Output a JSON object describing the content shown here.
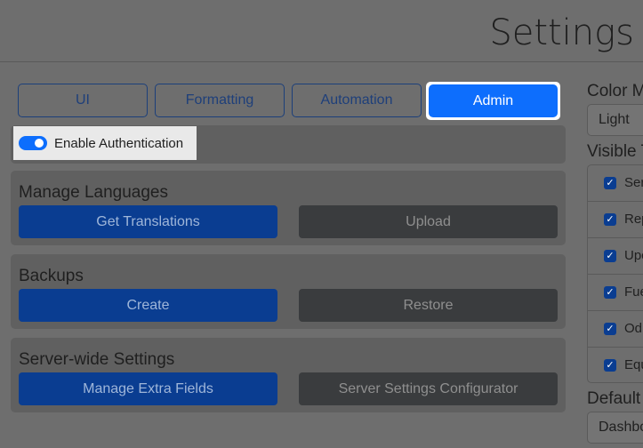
{
  "header": {
    "title": "Settings"
  },
  "tabs": [
    "UI",
    "Formatting",
    "Automation",
    "Admin"
  ],
  "auth": {
    "label": "Enable Authentication",
    "enabled": true
  },
  "sections": [
    {
      "title": "Manage Languages",
      "primary": "Get Translations",
      "secondary": "Upload"
    },
    {
      "title": "Backups",
      "primary": "Create",
      "secondary": "Restore"
    },
    {
      "title": "Server-wide Settings",
      "primary": "Manage Extra Fields",
      "secondary": "Server Settings Configurator"
    }
  ],
  "sidebar": {
    "color_mode_label": "Color M",
    "color_mode_value": "Light",
    "visible_label": "Visible T",
    "visible_items": [
      "Ser",
      "Rep",
      "Upc",
      "Fue",
      "Od",
      "Equ"
    ],
    "default_label": "Default",
    "default_value": "Dashbo"
  },
  "colors": {
    "accent": "#0d6efd",
    "primary_dim": "#0a3d91",
    "overlay": "#6e6e6e"
  }
}
